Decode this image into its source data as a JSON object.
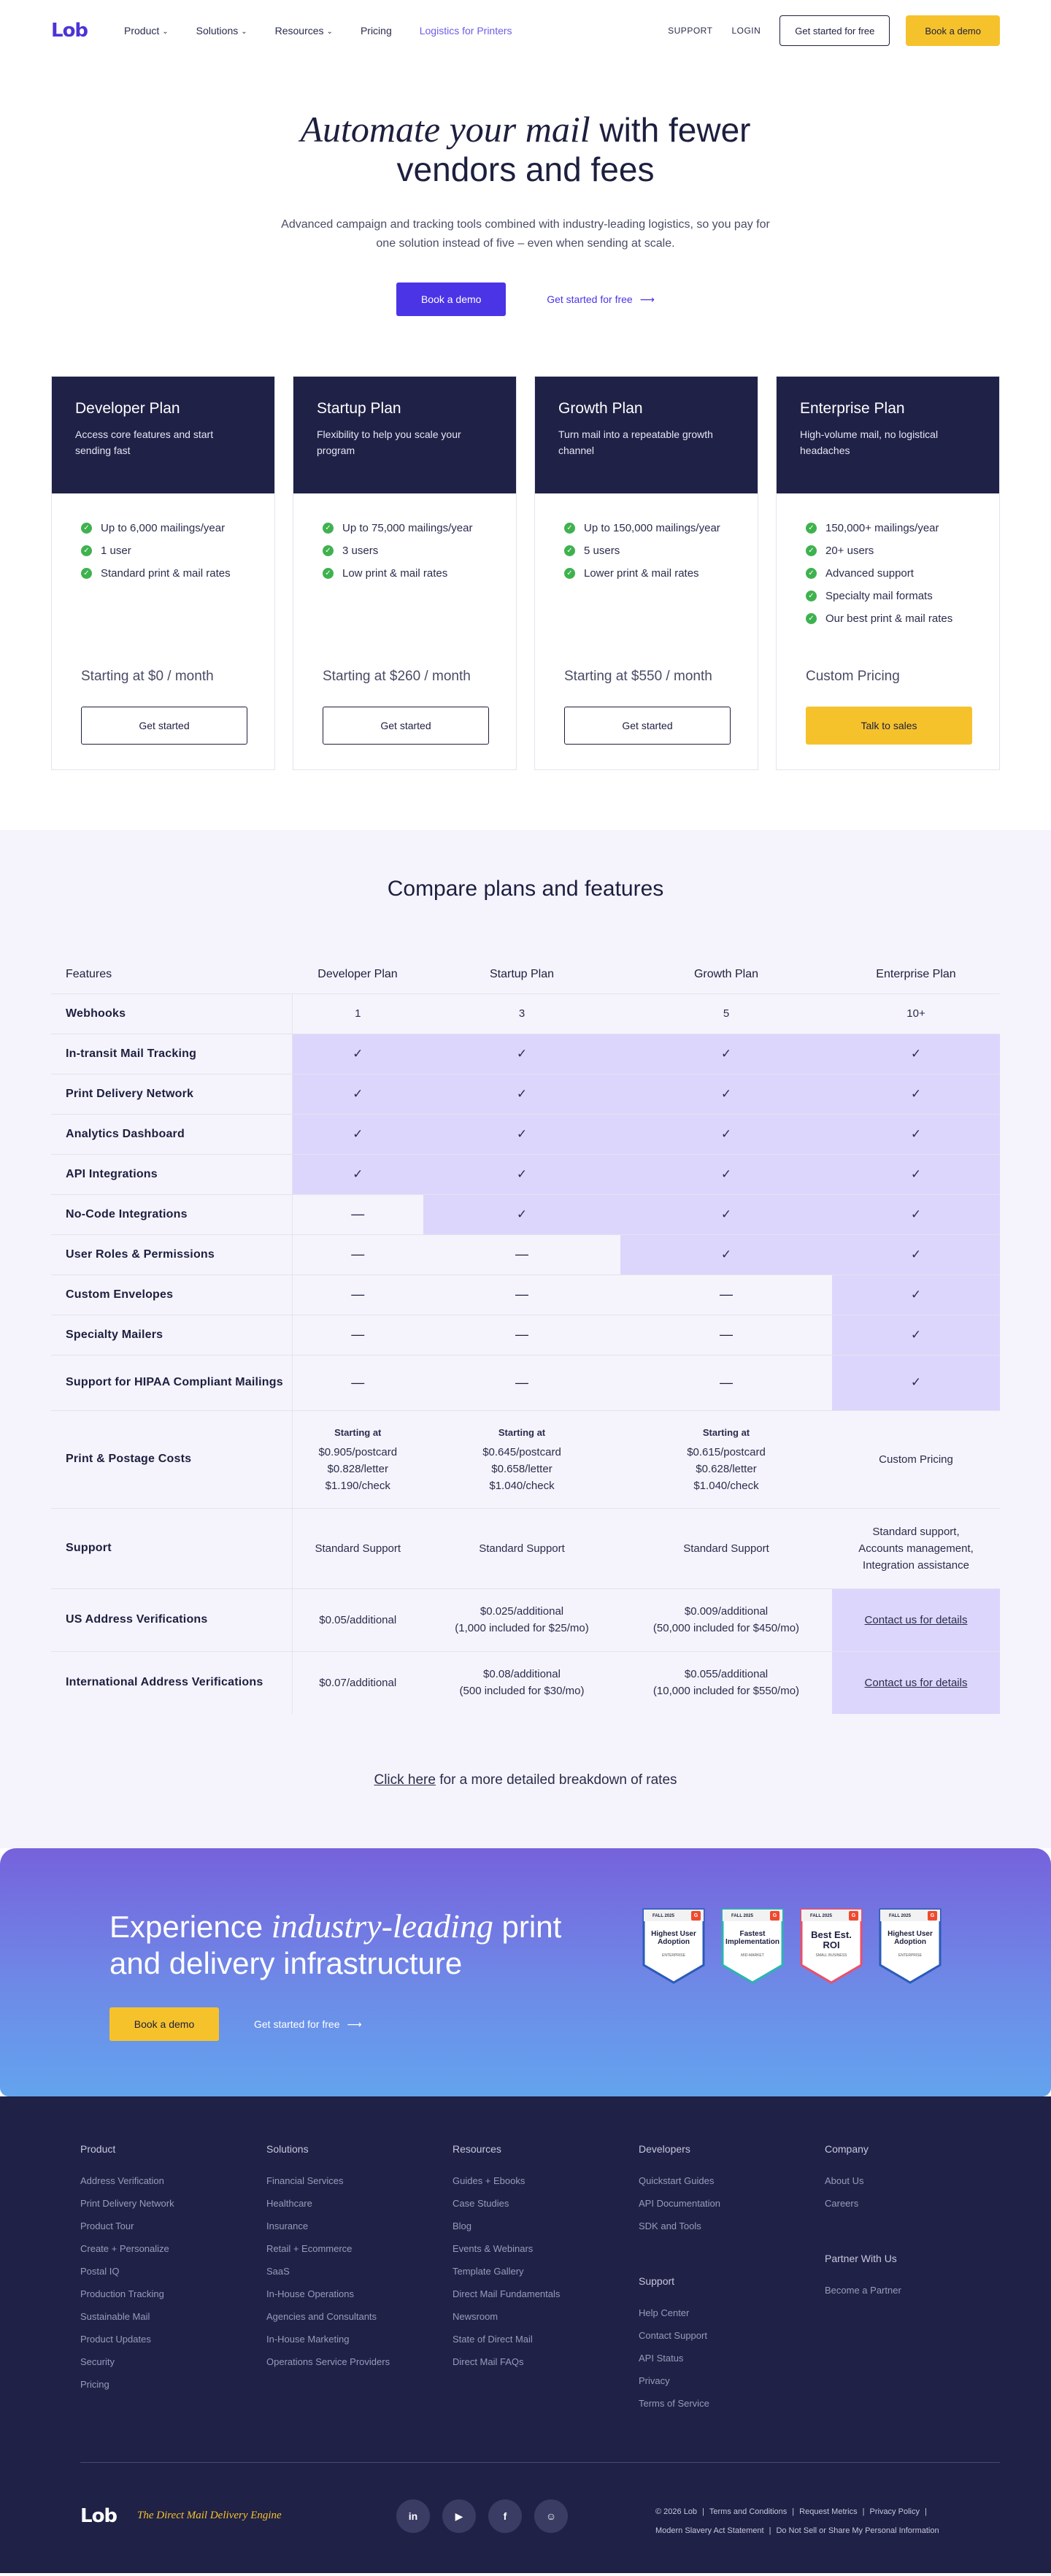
{
  "nav": {
    "logo": "Lob",
    "links": [
      {
        "label": "Product",
        "dropdown": true
      },
      {
        "label": "Solutions",
        "dropdown": true
      },
      {
        "label": "Resources",
        "dropdown": true
      },
      {
        "label": "Pricing",
        "dropdown": false
      },
      {
        "label": "Logistics for Printers",
        "dropdown": false
      }
    ],
    "support": "SUPPORT",
    "login": "LOGIN",
    "get_started": "Get started for free",
    "book_demo": "Book a demo"
  },
  "hero": {
    "title_italic": "Automate your mail",
    "title_rest": " with fewer",
    "title_line2": "vendors and fees",
    "subtitle": "Advanced campaign and tracking tools combined with industry-leading logistics, so you pay for one solution instead of five – even when sending at scale.",
    "book_demo": "Book a demo",
    "get_started": "Get started for free"
  },
  "plans": [
    {
      "name": "Developer Plan",
      "desc": "Access core features and start sending fast",
      "features": [
        "Up to 6,000 mailings/year",
        "1 user",
        "Standard print & mail rates"
      ],
      "price": "Starting at $0 / month",
      "cta": "Get started",
      "highlight": false
    },
    {
      "name": "Startup Plan",
      "desc": "Flexibility to help you scale your program",
      "features": [
        "Up to 75,000 mailings/year",
        "3 users",
        "Low print & mail rates"
      ],
      "price": "Starting at $260 / month",
      "cta": "Get started",
      "highlight": false
    },
    {
      "name": "Growth Plan",
      "desc": "Turn mail into a repeatable growth channel",
      "features": [
        "Up to 150,000 mailings/year",
        "5 users",
        "Lower print & mail rates"
      ],
      "price": "Starting at $550 / month",
      "cta": "Get started",
      "highlight": false
    },
    {
      "name": "Enterprise Plan",
      "desc": "High-volume mail, no logistical headaches",
      "features": [
        "150,000+ mailings/year",
        "20+ users",
        "Advanced support",
        "Specialty mail formats",
        "Our best print & mail rates"
      ],
      "price": "Custom Pricing",
      "cta": "Talk to sales",
      "highlight": true
    }
  ],
  "compare": {
    "title": "Compare plans and features",
    "headers": [
      "Features",
      "Developer Plan",
      "Startup Plan",
      "Growth Plan",
      "Enterprise Plan"
    ],
    "check": "✓",
    "dash": "—",
    "rows": [
      {
        "feature": "Webhooks",
        "cells": [
          "1",
          "3",
          "5",
          "10+"
        ],
        "hl": [
          false,
          false,
          false,
          false
        ]
      },
      {
        "feature": "In-transit Mail Tracking",
        "cells": [
          "check",
          "check",
          "check",
          "check"
        ],
        "hl": [
          true,
          true,
          true,
          true
        ]
      },
      {
        "feature": "Print Delivery Network",
        "cells": [
          "check",
          "check",
          "check",
          "check"
        ],
        "hl": [
          true,
          true,
          true,
          true
        ]
      },
      {
        "feature": "Analytics Dashboard",
        "cells": [
          "check",
          "check",
          "check",
          "check"
        ],
        "hl": [
          true,
          true,
          true,
          true
        ]
      },
      {
        "feature": "API Integrations",
        "cells": [
          "check",
          "check",
          "check",
          "check"
        ],
        "hl": [
          true,
          true,
          true,
          true
        ]
      },
      {
        "feature": "No-Code Integrations",
        "cells": [
          "dash",
          "check",
          "check",
          "check"
        ],
        "hl": [
          false,
          true,
          true,
          true
        ]
      },
      {
        "feature": "User Roles & Permissions",
        "cells": [
          "dash",
          "dash",
          "check",
          "check"
        ],
        "hl": [
          false,
          false,
          true,
          true
        ]
      },
      {
        "feature": "Custom Envelopes",
        "cells": [
          "dash",
          "dash",
          "dash",
          "check"
        ],
        "hl": [
          false,
          false,
          false,
          true
        ]
      },
      {
        "feature": "Specialty Mailers",
        "cells": [
          "dash",
          "dash",
          "dash",
          "check"
        ],
        "hl": [
          false,
          false,
          false,
          true
        ]
      },
      {
        "feature": "Support for HIPAA Compliant Mailings",
        "cells": [
          "dash",
          "dash",
          "dash",
          "check"
        ],
        "hl": [
          false,
          false,
          false,
          true
        ]
      }
    ],
    "postage": {
      "feature": "Print & Postage Costs",
      "starting": "Starting at",
      "cells": [
        [
          "$0.905/postcard",
          "$0.828/letter",
          "$1.190/check"
        ],
        [
          "$0.645/postcard",
          "$0.658/letter",
          "$1.040/check"
        ],
        [
          "$0.615/postcard",
          "$0.628/letter",
          "$1.040/check"
        ]
      ],
      "enterprise": "Custom Pricing"
    },
    "support": {
      "feature": "Support",
      "cells": [
        "Standard Support",
        "Standard Support",
        "Standard Support"
      ],
      "enterprise": [
        "Standard support,",
        "Accounts management,",
        "Integration assistance"
      ]
    },
    "us_av": {
      "feature": "US Address Verifications",
      "cells": [
        [
          "$0.05/additional"
        ],
        [
          "$0.025/additional",
          "(1,000 included for $25/mo)"
        ],
        [
          "$0.009/additional",
          "(50,000 included for $450/mo)"
        ]
      ],
      "enterprise": "Contact us for details"
    },
    "intl_av": {
      "feature": "International Address Verifications",
      "cells": [
        [
          "$0.07/additional"
        ],
        [
          "$0.08/additional",
          "(500 included for $30/mo)"
        ],
        [
          "$0.055/additional",
          "(10,000 included for $550/mo)"
        ]
      ],
      "enterprise": "Contact us for details"
    },
    "rates_link": "Click here",
    "rates_rest": " for a more detailed breakdown of rates"
  },
  "banner": {
    "title_a": "Experience ",
    "title_italic": "industry-leading",
    "title_b": " print",
    "title_line2": "and delivery infrastructure",
    "book_demo": "Book a demo",
    "get_started": "Get started for free",
    "badges": [
      {
        "season": "FALL 2025",
        "title": "Highest User Adoption",
        "sub": "ENTERPRISE"
      },
      {
        "season": "FALL 2025",
        "title": "Fastest Implementation",
        "sub": "MID-MARKET"
      },
      {
        "season": "FALL 2025",
        "title": "Best Est. ROI",
        "sub": "SMALL BUSINESS"
      },
      {
        "season": "FALL 2025",
        "title": "Highest User Adoption",
        "sub": "ENTERPRISE"
      }
    ]
  },
  "footer": {
    "columns": [
      {
        "heading": "Product",
        "items": [
          "Address Verification",
          "Print Delivery Network",
          "Product Tour",
          "Create + Personalize",
          "Postal IQ",
          "Production Tracking",
          "Sustainable Mail",
          "Product Updates",
          "Security",
          "Pricing"
        ]
      },
      {
        "heading": "Solutions",
        "items": [
          "Financial Services",
          "Healthcare",
          "Insurance",
          "Retail + Ecommerce",
          "SaaS",
          "In-House Operations",
          "Agencies and Consultants",
          "In-House Marketing",
          "Operations Service Providers"
        ]
      },
      {
        "heading": "Resources",
        "items": [
          "Guides + Ebooks",
          "Case Studies",
          "Blog",
          "Events & Webinars",
          "Template Gallery",
          "Direct Mail Fundamentals",
          "Newsroom",
          "State of Direct Mail",
          "Direct Mail FAQs"
        ]
      },
      {
        "heading": "Developers",
        "items": [
          "Quickstart Guides",
          "API Documentation",
          "SDK and Tools"
        ],
        "heading2": "Support",
        "items2": [
          "Help Center",
          "Contact Support",
          "API Status",
          "Privacy",
          "Terms of Service"
        ]
      },
      {
        "heading": "Company",
        "items": [
          "About Us",
          "Careers"
        ],
        "heading2": "Partner With Us",
        "items2": [
          "Become a Partner"
        ]
      }
    ],
    "logo": "Lob",
    "tagline": "The Direct Mail Delivery Engine",
    "socials": [
      "in",
      "▶",
      "f",
      "☺"
    ],
    "legal_line1": [
      "© 2026 Lob",
      "Terms and Conditions",
      "Request Metrics",
      "Privacy Policy"
    ],
    "legal_line2": [
      "Modern Slavery Act Statement",
      "Do Not Sell or Share My Personal Information"
    ]
  }
}
